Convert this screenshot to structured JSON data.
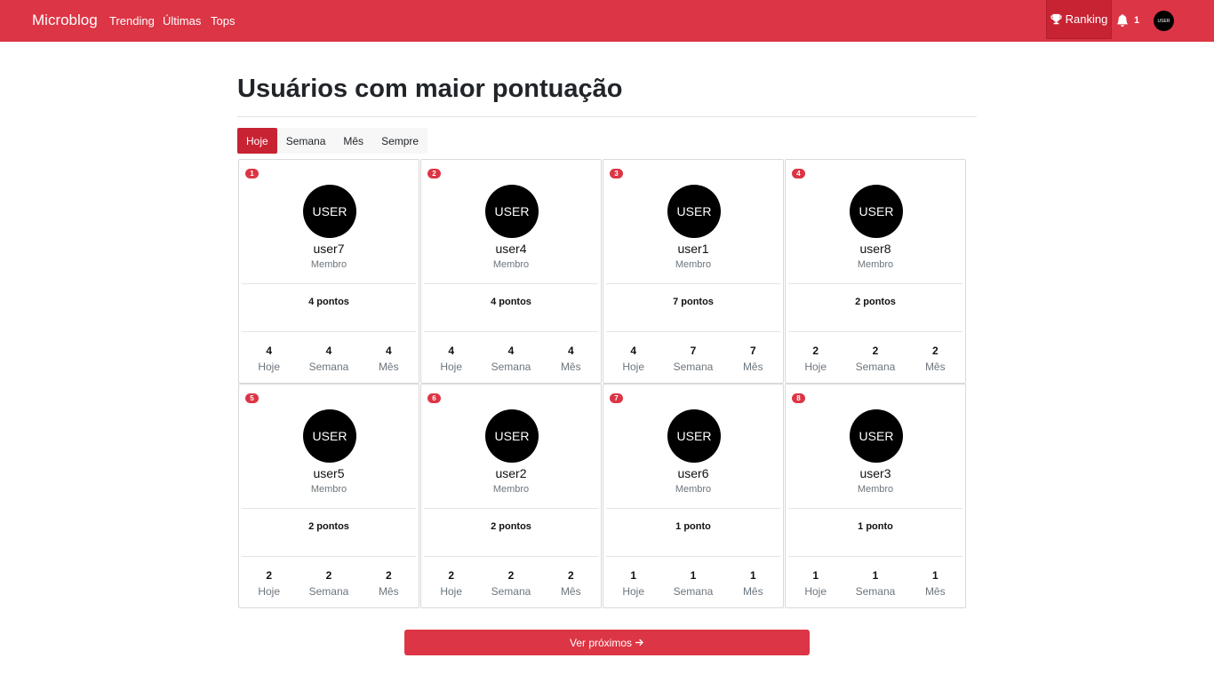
{
  "nav": {
    "brand": "Microblog",
    "links": [
      "Trending",
      "Últimas",
      "Tops"
    ],
    "ranking_label": "Ranking",
    "notification_count": "1",
    "avatar_label": "USER"
  },
  "page": {
    "title": "Usuários com maior pontuação"
  },
  "tabs": [
    {
      "label": "Hoje",
      "active": true
    },
    {
      "label": "Semana",
      "active": false
    },
    {
      "label": "Mês",
      "active": false
    },
    {
      "label": "Sempre",
      "active": false
    }
  ],
  "users": [
    {
      "rank": "1",
      "avatar": "USER",
      "name": "user7",
      "role": "Membro",
      "points": "4 pontos",
      "stats": [
        {
          "value": "4",
          "label": "Hoje"
        },
        {
          "value": "4",
          "label": "Semana"
        },
        {
          "value": "4",
          "label": "Mês"
        }
      ]
    },
    {
      "rank": "2",
      "avatar": "USER",
      "name": "user4",
      "role": "Membro",
      "points": "4 pontos",
      "stats": [
        {
          "value": "4",
          "label": "Hoje"
        },
        {
          "value": "4",
          "label": "Semana"
        },
        {
          "value": "4",
          "label": "Mês"
        }
      ]
    },
    {
      "rank": "3",
      "avatar": "USER",
      "name": "user1",
      "role": "Membro",
      "points": "7 pontos",
      "stats": [
        {
          "value": "4",
          "label": "Hoje"
        },
        {
          "value": "7",
          "label": "Semana"
        },
        {
          "value": "7",
          "label": "Mês"
        }
      ]
    },
    {
      "rank": "4",
      "avatar": "USER",
      "name": "user8",
      "role": "Membro",
      "points": "2 pontos",
      "stats": [
        {
          "value": "2",
          "label": "Hoje"
        },
        {
          "value": "2",
          "label": "Semana"
        },
        {
          "value": "2",
          "label": "Mês"
        }
      ]
    },
    {
      "rank": "5",
      "avatar": "USER",
      "name": "user5",
      "role": "Membro",
      "points": "2 pontos",
      "stats": [
        {
          "value": "2",
          "label": "Hoje"
        },
        {
          "value": "2",
          "label": "Semana"
        },
        {
          "value": "2",
          "label": "Mês"
        }
      ]
    },
    {
      "rank": "6",
      "avatar": "USER",
      "name": "user2",
      "role": "Membro",
      "points": "2 pontos",
      "stats": [
        {
          "value": "2",
          "label": "Hoje"
        },
        {
          "value": "2",
          "label": "Semana"
        },
        {
          "value": "2",
          "label": "Mês"
        }
      ]
    },
    {
      "rank": "7",
      "avatar": "USER",
      "name": "user6",
      "role": "Membro",
      "points": "1 ponto",
      "stats": [
        {
          "value": "1",
          "label": "Hoje"
        },
        {
          "value": "1",
          "label": "Semana"
        },
        {
          "value": "1",
          "label": "Mês"
        }
      ]
    },
    {
      "rank": "8",
      "avatar": "USER",
      "name": "user3",
      "role": "Membro",
      "points": "1 ponto",
      "stats": [
        {
          "value": "1",
          "label": "Hoje"
        },
        {
          "value": "1",
          "label": "Semana"
        },
        {
          "value": "1",
          "label": "Mês"
        }
      ]
    }
  ],
  "next_button": {
    "label": "Ver próximos"
  },
  "colors": {
    "primary": "#dc3545",
    "primary_dark": "#c82333"
  },
  "icons": {
    "ranking": "trophy-icon",
    "notifications": "bell-icon",
    "next": "arrow-right-icon"
  }
}
